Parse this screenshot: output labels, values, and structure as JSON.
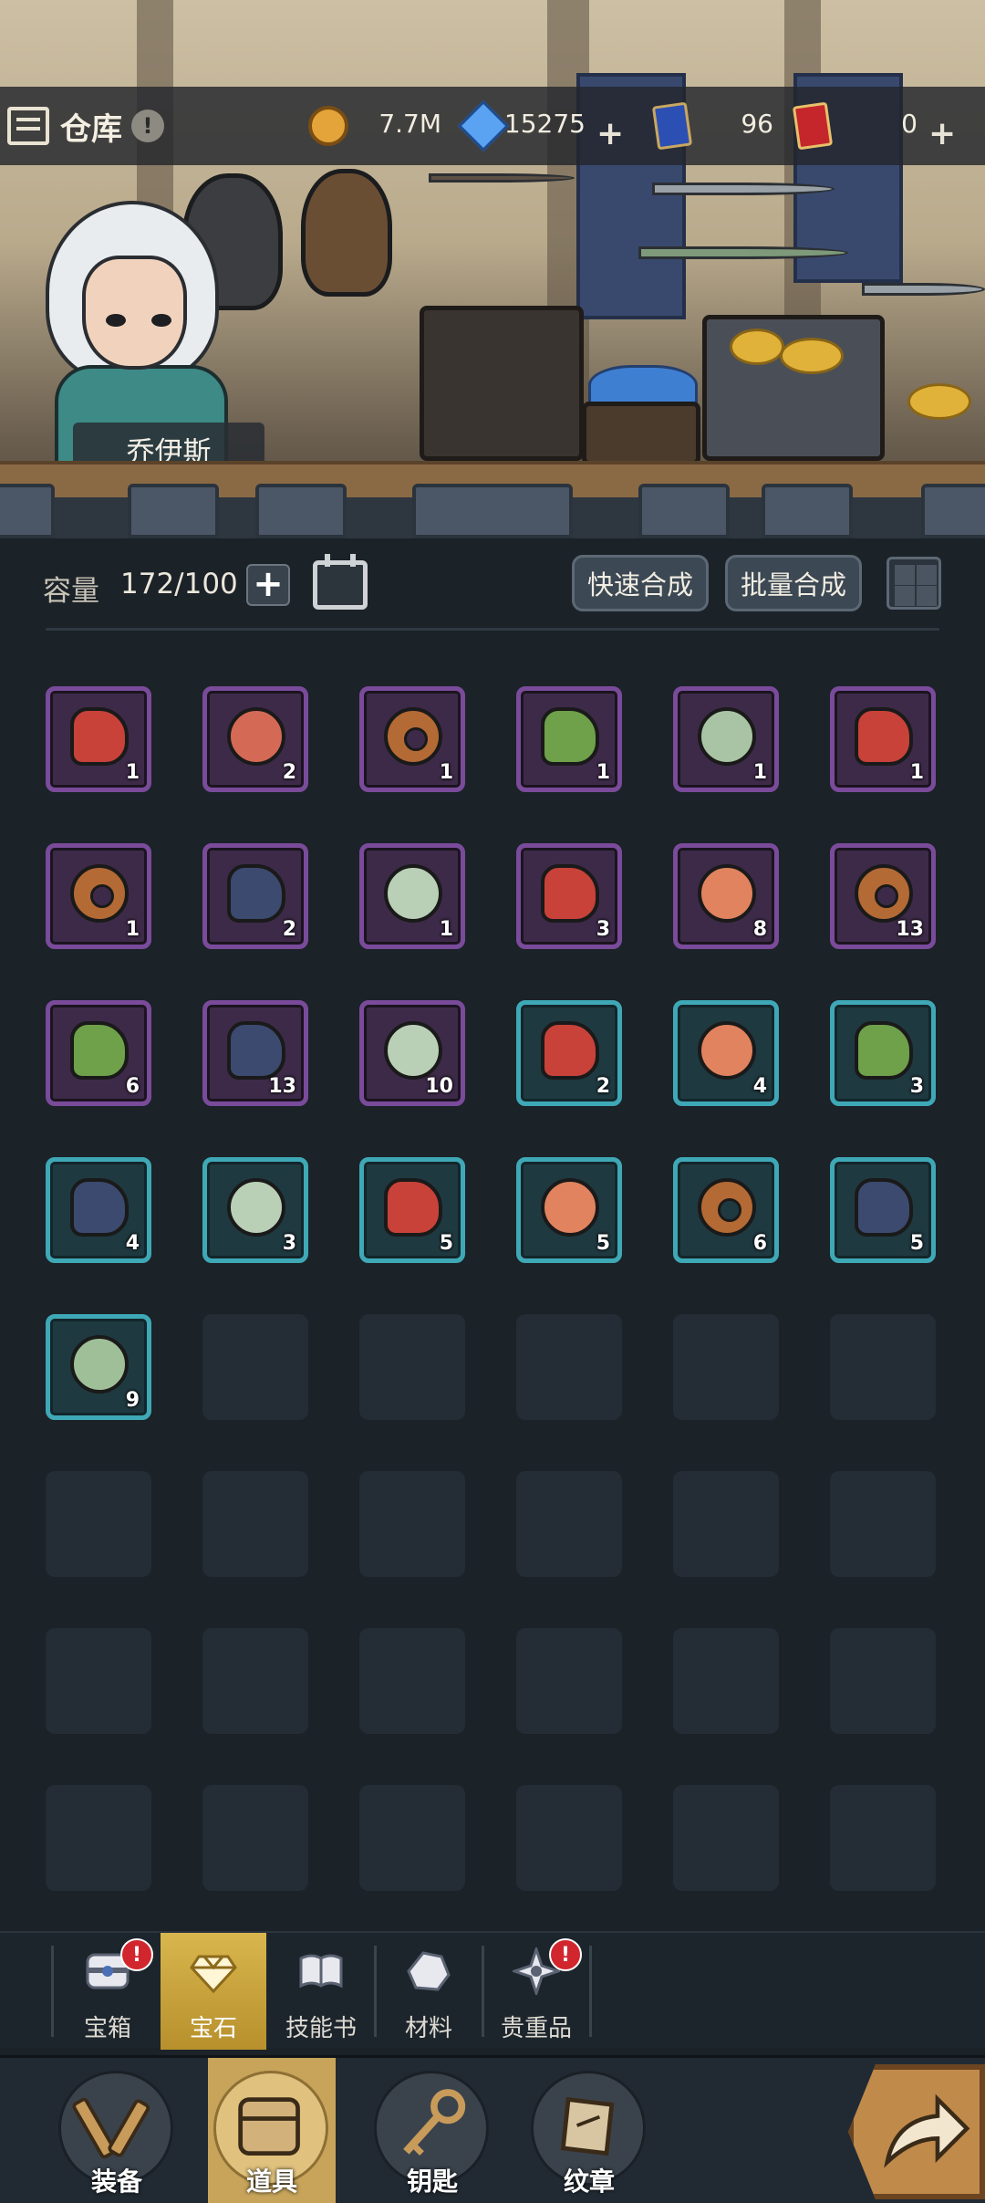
{
  "header": {
    "title": "仓库",
    "alert": "!",
    "resources": {
      "gold": "7.7M",
      "diamond": "15275",
      "blue_card": "96",
      "red_card": "0"
    },
    "plus_symbol": "+"
  },
  "scene": {
    "character_name": "乔伊斯"
  },
  "capacity": {
    "label": "容量",
    "value": "172/100",
    "plus": "+"
  },
  "actions": {
    "quick_compose": "快速合成",
    "batch_compose": "批量合成"
  },
  "inventory": {
    "items": [
      {
        "count": "1",
        "color": "#c8423a",
        "shape": "rock",
        "frame": "purple"
      },
      {
        "count": "2",
        "color": "#d46a55",
        "shape": "round",
        "frame": "purple"
      },
      {
        "count": "1",
        "color": "#b46a34",
        "shape": "ring",
        "frame": "purple"
      },
      {
        "count": "1",
        "color": "#6fa04a",
        "shape": "rock",
        "frame": "purple"
      },
      {
        "count": "1",
        "color": "#a9c4a4",
        "shape": "round",
        "frame": "purple"
      },
      {
        "count": "1",
        "color": "#c8423a",
        "shape": "rock",
        "frame": "purple"
      },
      {
        "count": "1",
        "color": "#b46a34",
        "shape": "ring",
        "frame": "purple"
      },
      {
        "count": "2",
        "color": "#3b4a6e",
        "shape": "rock",
        "frame": "purple"
      },
      {
        "count": "1",
        "color": "#b9d0b6",
        "shape": "round",
        "frame": "purple"
      },
      {
        "count": "3",
        "color": "#c8423a",
        "shape": "rock",
        "frame": "purple"
      },
      {
        "count": "8",
        "color": "#e0835e",
        "shape": "round",
        "frame": "purple"
      },
      {
        "count": "13",
        "color": "#b46a34",
        "shape": "ring",
        "frame": "purple"
      },
      {
        "count": "6",
        "color": "#6fa04a",
        "shape": "rock",
        "frame": "purple"
      },
      {
        "count": "13",
        "color": "#3b4a6e",
        "shape": "rock",
        "frame": "purple"
      },
      {
        "count": "10",
        "color": "#b9d0b6",
        "shape": "round",
        "frame": "purple"
      },
      {
        "count": "2",
        "color": "#c8423a",
        "shape": "rock",
        "frame": "blue"
      },
      {
        "count": "4",
        "color": "#e0835e",
        "shape": "round",
        "frame": "blue"
      },
      {
        "count": "3",
        "color": "#6fa04a",
        "shape": "rock",
        "frame": "blue"
      },
      {
        "count": "4",
        "color": "#3b4a6e",
        "shape": "rock",
        "frame": "blue"
      },
      {
        "count": "3",
        "color": "#b9d0b6",
        "shape": "round",
        "frame": "blue"
      },
      {
        "count": "5",
        "color": "#c8423a",
        "shape": "rock",
        "frame": "blue"
      },
      {
        "count": "5",
        "color": "#e0835e",
        "shape": "round",
        "frame": "blue"
      },
      {
        "count": "6",
        "color": "#b46a34",
        "shape": "ring",
        "frame": "blue"
      },
      {
        "count": "5",
        "color": "#3b4a6e",
        "shape": "rock",
        "frame": "blue"
      },
      {
        "count": "9",
        "color": "#9fbf99",
        "shape": "round",
        "frame": "blue"
      }
    ],
    "empty_slots": 23
  },
  "categories": [
    {
      "label": "宝箱",
      "icon": "chest-icon",
      "alert": "!"
    },
    {
      "label": "宝石",
      "icon": "gem-icon",
      "active": true
    },
    {
      "label": "技能书",
      "icon": "book-icon"
    },
    {
      "label": "材料",
      "icon": "material-icon"
    },
    {
      "label": "贵重品",
      "icon": "valuable-icon",
      "alert": "!"
    }
  ],
  "nav": [
    {
      "label": "装备",
      "icon": "equipment-icon"
    },
    {
      "label": "道具",
      "icon": "item-icon",
      "active": true
    },
    {
      "label": "钥匙",
      "icon": "key-icon"
    },
    {
      "label": "纹章",
      "icon": "emblem-icon"
    }
  ],
  "colors": {
    "accent_gold": "#c7a45a",
    "purple_frame": "#7a4b9a",
    "blue_frame": "#3fa8b6",
    "alert_red": "#d2262e"
  }
}
